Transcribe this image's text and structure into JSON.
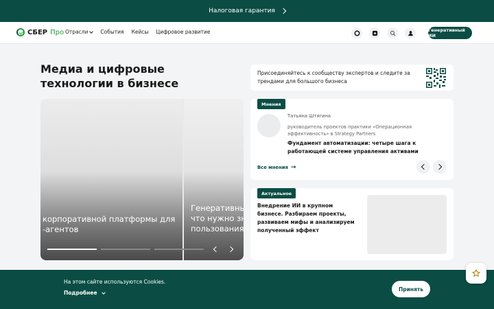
{
  "topbar": {
    "text": "Налоговая гарантия"
  },
  "nav": {
    "logo_main": "СБЕР",
    "logo_pro": "Про",
    "items": [
      "Отрасли",
      "События",
      "Кейсы",
      "Цифровое развитие"
    ],
    "icons": [
      "chat-icon",
      "plus-icon",
      "search-icon",
      "user-icon"
    ],
    "ai_button": "Генеративный ИИ"
  },
  "main": {
    "title": "Медиа и цифровые технологии в бизнесе",
    "slides": [
      {
        "text": "корпоративной платформы для\n-агентов"
      },
      {
        "text": "Генеративны\nчто нужно зн\nпользования"
      }
    ]
  },
  "community": {
    "text": "Присоединяйтесь к сообществу экспертов и следите за трендами для большого бизнеса"
  },
  "opinion": {
    "tag": "Мнения",
    "author": "Татьяна Штягина",
    "role": "руководитель проектов практики «Операционная эффективность» в Strategy Partners",
    "headline": "Фундамент автоматизации: четыре шага к работающей системе управления активами",
    "all_link": "Все мнения"
  },
  "actual": {
    "tag": "Актуальное",
    "headline": "Внедрение ИИ в крупном бизнесе. Разбираем проекты, развиваем мифы и анализируем полученный эффект"
  },
  "cookie": {
    "message": "На этом сайте используются Cookies.",
    "more": "Подробнее",
    "accept": "Принять"
  },
  "colors": {
    "brand": "#0b4d44",
    "accent": "#21a038",
    "fav_star": "#b8860b"
  }
}
